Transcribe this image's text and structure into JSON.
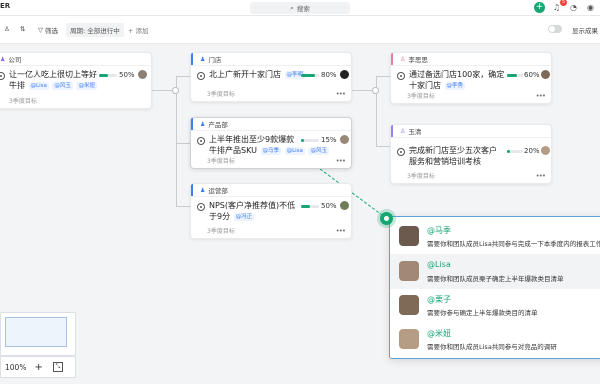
{
  "topbar": {
    "app_title": "ER",
    "search_placeholder": "搜索",
    "notif_count": "5"
  },
  "toolbar": {
    "filter_label": "筛选",
    "period_label": "周期: 全部进行中",
    "add_label": "+ 添加",
    "toggle_label": "显示成果"
  },
  "cards": {
    "company": {
      "head": "公司",
      "goal_line1": "让一亿人吃上很切上等好",
      "goal_line2": "牛排",
      "tag1": "@Lisa",
      "tag2": "@风玉",
      "tag3": "@米妞",
      "pct": "50%",
      "progress": 50,
      "foot": "3季度目标"
    },
    "store": {
      "head": "门店",
      "goal_line1": "北上广新开十家门店",
      "tag1": "@李明",
      "pct": "80%",
      "progress": 80,
      "foot": "3季度目标"
    },
    "product": {
      "head": "产品部",
      "goal_line1": "上半年推出至少9款爆款",
      "goal_line2": "牛排产品SKU",
      "tag1": "@马季",
      "tag2": "@Lisa",
      "tag3": "@风玉",
      "pct": "15%",
      "progress": 15,
      "foot": "3季度目标"
    },
    "ops": {
      "head": "运营部",
      "goal_line1": "NPS(客户净推荐值)不低",
      "goal_line2": "于9分",
      "tag1": "@冯正",
      "pct": "50%",
      "progress": 50,
      "foot": "3季度目标"
    },
    "lisi": {
      "head": "李思思",
      "goal_line1": "通过备选门店100家，确定",
      "goal_line2": "十家门店",
      "tag1": "@李秀",
      "pct": "60%",
      "progress": 60,
      "foot": "3季度目标"
    },
    "yuqing": {
      "head": "玉清",
      "goal_line1": "完成新门店至少五次客户",
      "goal_line2": "服务和营销培训考核",
      "pct": "20%",
      "progress": 20,
      "foot": "3季度目标"
    }
  },
  "mentions": [
    {
      "name": "@马季",
      "desc": "需要你和团队成员Lisa共同参与完成一下本季度内的报表工作",
      "avatar_color": "#6b5a4d"
    },
    {
      "name": "@Lisa",
      "desc": "需要你和团队成员栗子确定上半年爆款类目清单",
      "avatar_color": "#a08a76"
    },
    {
      "name": "@栗子",
      "desc": "需要你参与确定上半年爆款类目的清单",
      "avatar_color": "#7f6a58"
    },
    {
      "name": "@米妞",
      "desc": "需要你和团队成员Lisa共同参与对竞品的调研",
      "avatar_color": "#b59c85"
    }
  ],
  "zoom": {
    "level": "100%",
    "plus": "+",
    "fit": "⤡"
  },
  "colors": {
    "accent": "#17a673",
    "link_blue": "#3d7ef5",
    "popup_border": "#5aa2d8"
  }
}
